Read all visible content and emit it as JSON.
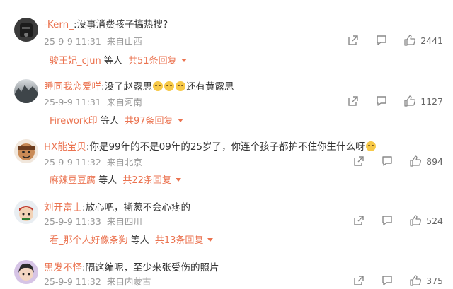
{
  "comments": [
    {
      "user": "-Kern_",
      "text": "没事消费孩子搞热搜?",
      "time": "25-9-9 11:31",
      "location": "来自山西",
      "likes": "2441",
      "reply_user": "骏王妃_cjun",
      "reply_mid": "等人",
      "reply_total": "共51条回复"
    },
    {
      "user": "睡同我恋爱咩",
      "text_before": "没了赵露思",
      "text_after": "还有黄露思",
      "emoji_count": 3,
      "time": "25-9-9 11:31",
      "location": "来自河南",
      "likes": "1127",
      "reply_user": "Firework印",
      "reply_mid": "等人",
      "reply_total": "共97条回复"
    },
    {
      "user": "HX能宝贝",
      "text": "你是99年的不是09年的25岁了，你连个孩子都护不住你生什么呀",
      "time": "25-9-9 11:32",
      "location": "来自北京",
      "likes": "894",
      "reply_user": "麻辣豆豆腐",
      "reply_mid": "等人",
      "reply_total": "共22条回复"
    },
    {
      "user": "刘开富士",
      "text": "放心吧，撕葱不会心疼的",
      "time": "25-9-9 11:33",
      "location": "来自四川",
      "likes": "524",
      "reply_user": "看_那个人好像条狗",
      "reply_mid": "等人",
      "reply_total": "共13条回复"
    },
    {
      "user": "黑发不怪",
      "text": "隔这编呢，至少来张受伤的照片",
      "time": "25-9-9 11:32",
      "location": "来自内蒙古",
      "likes": "375"
    }
  ],
  "icons": {
    "share": "share-icon",
    "comment": "comment-icon",
    "like": "thumbs-up-icon"
  },
  "colors": {
    "username": "#eb7350",
    "meta": "#999999",
    "body": "#333333"
  }
}
